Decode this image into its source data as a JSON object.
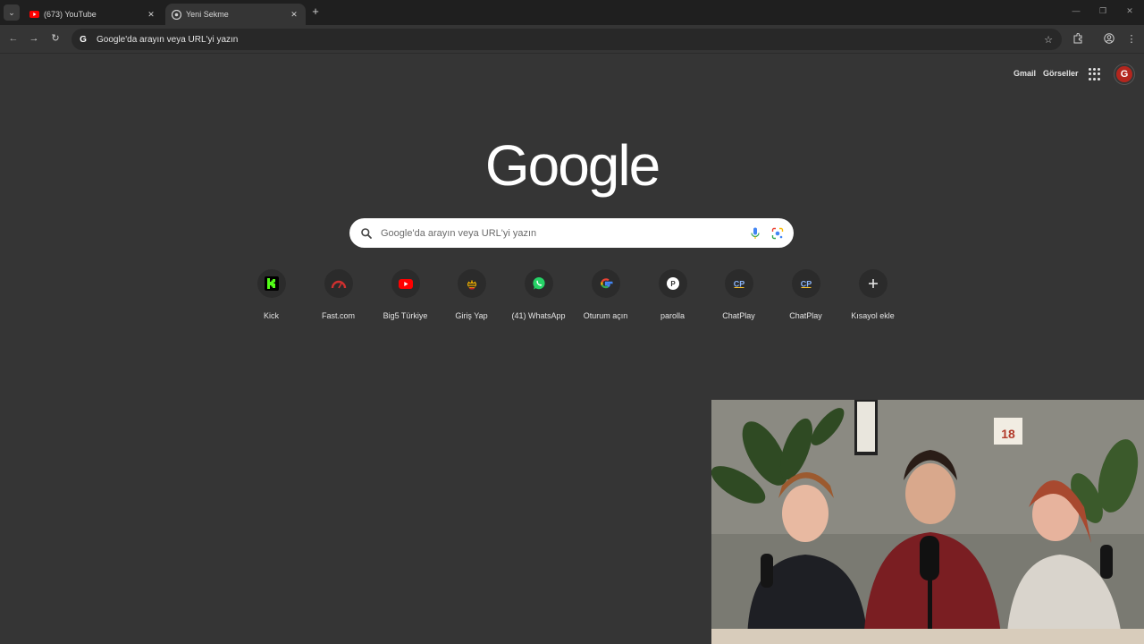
{
  "browser": {
    "tabs": [
      {
        "title": "(673) YouTube",
        "icon": "youtube-icon",
        "active": false
      },
      {
        "title": "Yeni Sekme",
        "icon": "chrome-icon",
        "active": true
      }
    ],
    "address_bar": {
      "placeholder": "Google'da arayın veya URL'yi yazın"
    }
  },
  "header": {
    "gmail": "Gmail",
    "images": "Görseller",
    "avatar_letter": "G"
  },
  "logo": "Google",
  "search": {
    "placeholder": "Google'da arayın veya URL'yi yazın"
  },
  "shortcuts": [
    {
      "label": "Kick",
      "icon": "kick-icon"
    },
    {
      "label": "Fast.com",
      "icon": "fast-icon"
    },
    {
      "label": "Big5 Türkiye",
      "icon": "youtube-icon"
    },
    {
      "label": "Giriş Yap",
      "icon": "bee-icon"
    },
    {
      "label": "(41) WhatsApp",
      "icon": "whatsapp-icon"
    },
    {
      "label": "Oturum açın",
      "icon": "google-g-icon"
    },
    {
      "label": "parolla",
      "icon": "parolla-icon"
    },
    {
      "label": "ChatPlay",
      "icon": "chatplay-icon"
    },
    {
      "label": "ChatPlay",
      "icon": "chatplay-icon"
    },
    {
      "label": "Kısayol ekle",
      "icon": "plus-icon"
    }
  ],
  "webcam": {
    "poster_text": "18"
  },
  "colors": {
    "background": "#353535",
    "tabstrip": "#1f1f1f",
    "avatar": "#b3261e",
    "kick_green": "#53fc18",
    "whatsapp_green": "#25d366",
    "youtube_red": "#ff0000"
  }
}
